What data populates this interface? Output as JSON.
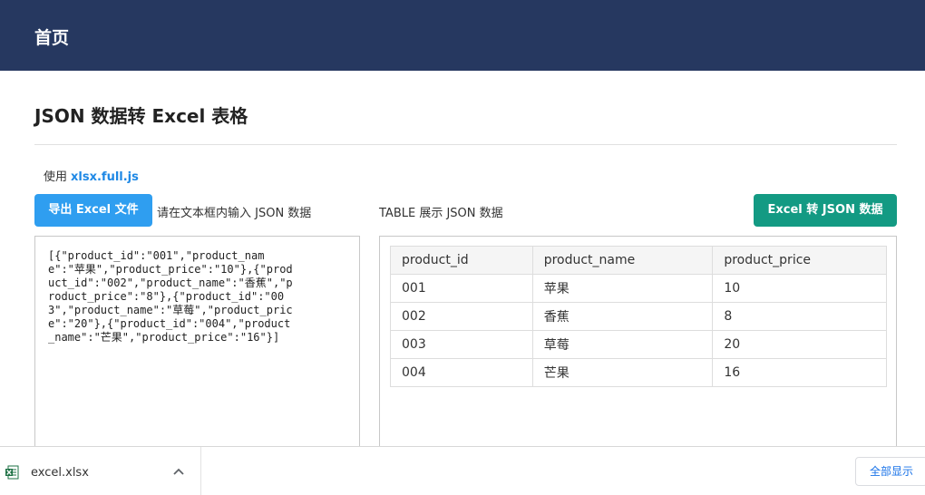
{
  "header": {
    "home": "首页"
  },
  "page": {
    "title": "JSON 数据转 Excel 表格"
  },
  "uses": {
    "prefix": "使用",
    "library": "xlsx.full.js"
  },
  "toolbar": {
    "export_label": "导出 Excel 文件",
    "input_hint": "请在文本框内输入 JSON 数据",
    "table_hint": "TABLE 展示 JSON 数据",
    "to_json_label": "Excel 转 JSON 数据"
  },
  "json_input": {
    "value": "[{\"product_id\":\"001\",\"product_name\":\"苹果\",\"product_price\":\"10\"},{\"product_id\":\"002\",\"product_name\":\"香蕉\",\"product_price\":\"8\"},{\"product_id\":\"003\",\"product_name\":\"草莓\",\"product_price\":\"20\"},{\"product_id\":\"004\",\"product_name\":\"芒果\",\"product_price\":\"16\"}]"
  },
  "table": {
    "columns": [
      "product_id",
      "product_name",
      "product_price"
    ],
    "rows": [
      [
        "001",
        "苹果",
        "10"
      ],
      [
        "002",
        "香蕉",
        "8"
      ],
      [
        "003",
        "草莓",
        "20"
      ],
      [
        "004",
        "芒果",
        "16"
      ]
    ]
  },
  "downloads": {
    "file_name": "excel.xlsx",
    "file_icon": "excel-file-icon",
    "show_all_label": "全部显示"
  },
  "colors": {
    "header_bg": "#263860",
    "export_button": "#2f9ef0",
    "to_json_button": "#139a83",
    "link": "#1e88e5"
  }
}
